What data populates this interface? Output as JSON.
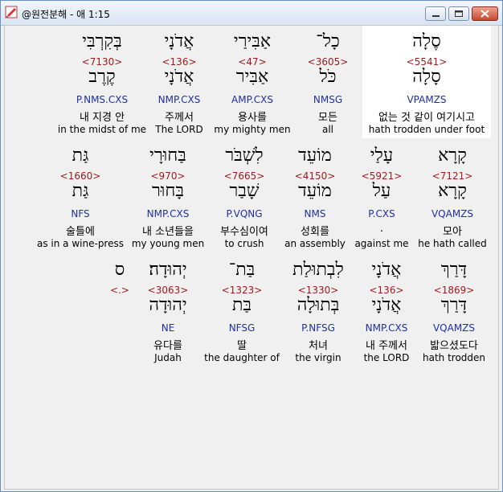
{
  "window": {
    "title": "@원전분해 - 애 1:15"
  },
  "rows": [
    {
      "words": [
        {
          "hebrew": "סֶלָה",
          "strong": "<5541>",
          "lexeme": "סָלָה",
          "parse": "VPAMZS",
          "korean": "없는 것 같이 여기시고",
          "english": "hath trodden under foot"
        },
        {
          "hebrew": "כָל־",
          "strong": "<3605>",
          "lexeme": "כֹּל",
          "parse": "NMSG",
          "korean": "모든",
          "english": "all"
        },
        {
          "hebrew": "אַבִּירַי",
          "strong": "<47>",
          "lexeme": "אַבִּיר",
          "parse": "AMP.CXS",
          "korean": "용사를",
          "english": "my mighty men"
        },
        {
          "hebrew": "אֲדֹנָי",
          "strong": "<136>",
          "lexeme": "אֲדֹנָי",
          "parse": "NMP.CXS",
          "korean": "주께서",
          "english": "The LORD"
        },
        {
          "hebrew": "בְּקִרְבִּי",
          "strong": "<7130>",
          "lexeme": "קֶרֶב",
          "parse": "P.NMS.CXS",
          "korean": "내 지경 안",
          "english": "in the midst of me"
        }
      ]
    },
    {
      "words": [
        {
          "hebrew": "קָרָא",
          "strong": "<7121>",
          "lexeme": "קָרָא",
          "parse": "VQAMZS",
          "korean": "모아",
          "english": "he hath called"
        },
        {
          "hebrew": "עָלַי",
          "strong": "<5921>",
          "lexeme": "עַל",
          "parse": "P.CXS",
          "korean": ".",
          "english": "against me"
        },
        {
          "hebrew": "מוֹעֵד",
          "strong": "<4150>",
          "lexeme": "מוֹעֵד",
          "parse": "NMS",
          "korean": "성회를",
          "english": "an assembly"
        },
        {
          "hebrew": "לִשְׁבֹּר",
          "strong": "<7665>",
          "lexeme": "שָׁבַר",
          "parse": "P.VQNG",
          "korean": "부수심이여",
          "english": "to crush"
        },
        {
          "hebrew": "בַּחוּרָי",
          "strong": "<970>",
          "lexeme": "בָּחוּר",
          "parse": "NMP.CXS",
          "korean": "내 소년들을",
          "english": "my young men"
        },
        {
          "hebrew": "גַּת",
          "strong": "<1660>",
          "lexeme": "גַּת",
          "parse": "NFS",
          "korean": "술틀에",
          "english": "as in a wine-press"
        }
      ]
    },
    {
      "words": [
        {
          "hebrew": "דָּרַךְ",
          "strong": "<1869>",
          "lexeme": "דָּרַךְ",
          "parse": "VQAMZS",
          "korean": "밟으셨도다",
          "english": "hath trodden"
        },
        {
          "hebrew": "אֲדֹנָי",
          "strong": "<136>",
          "lexeme": "אֲדֹנָי",
          "parse": "NMP.CXS",
          "korean": "내 주께서",
          "english": "the LORD"
        },
        {
          "hebrew": "לִבְתוּלַת",
          "strong": "<1330>",
          "lexeme": "בְּתוּלָה",
          "parse": "P.NFSG",
          "korean": "처녀",
          "english": "the virgin"
        },
        {
          "hebrew": "בַּת־",
          "strong": "<1323>",
          "lexeme": "בַּת",
          "parse": "NFSG",
          "korean": "딸",
          "english": "the daughter of"
        },
        {
          "hebrew": "יְהוּדָה׃",
          "strong": "<3063>",
          "lexeme": "יְהוּדָה",
          "parse": "NE",
          "korean": "유다를",
          "english": "Judah"
        },
        {
          "hebrew": "ס",
          "strong": "<.>",
          "lexeme": "",
          "parse": "",
          "korean": "",
          "english": ""
        }
      ]
    }
  ]
}
